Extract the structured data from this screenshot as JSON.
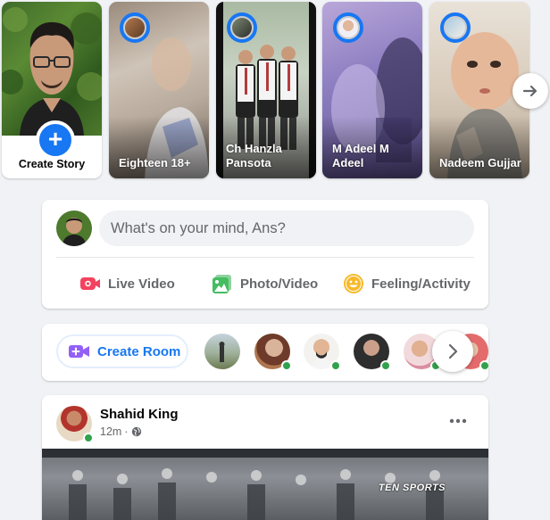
{
  "stories": {
    "create": {
      "label": "Create Story",
      "plus": "+"
    },
    "items": [
      {
        "name": "Eighteen 18+"
      },
      {
        "name": "Ch Hanzla Pansota"
      },
      {
        "name": "M Adeel M Adeel"
      },
      {
        "name": "Nadeem Gujjar"
      }
    ],
    "next_icon": "arrow-right-icon"
  },
  "composer": {
    "placeholder": "What's on your mind, Ans?",
    "actions": [
      {
        "label": "Live Video",
        "icon": "live-video-icon",
        "color": "#f3425f"
      },
      {
        "label": "Photo/Video",
        "icon": "photo-video-icon",
        "color": "#45bd62"
      },
      {
        "label": "Feeling/Activity",
        "icon": "feeling-icon",
        "color": "#f7b928"
      }
    ]
  },
  "rooms": {
    "create_label": "Create Room",
    "icon": "video-camera-plus-icon",
    "icon_color": "#9360f7"
  },
  "post": {
    "author": "Shahid King",
    "time": "12m",
    "separator": "·",
    "privacy_icon": "globe-icon",
    "more_icon": "more-options-icon",
    "watermark": "TEN SPORTS"
  },
  "colors": {
    "accent": "#1877f2",
    "background": "#f0f2f5",
    "online": "#31a24c",
    "secondary_text": "#65676b"
  }
}
